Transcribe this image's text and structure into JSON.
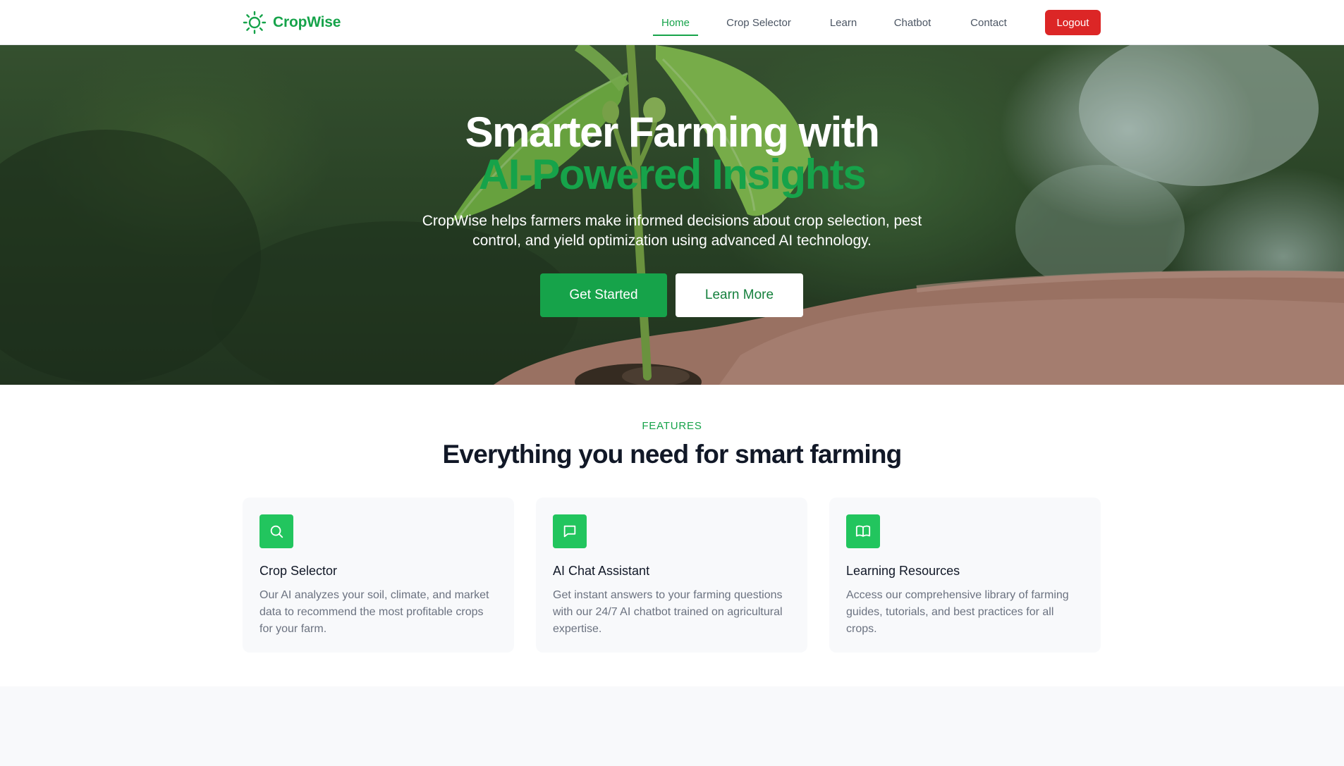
{
  "brand": {
    "name": "CropWise",
    "icon": "sun-icon",
    "color": "#16a34a"
  },
  "nav": {
    "items": [
      {
        "label": "Home",
        "active": true
      },
      {
        "label": "Crop Selector",
        "active": false
      },
      {
        "label": "Learn",
        "active": false
      },
      {
        "label": "Chatbot",
        "active": false
      },
      {
        "label": "Contact",
        "active": false
      }
    ],
    "logout_label": "Logout"
  },
  "hero": {
    "title_line1": "Smarter Farming with",
    "title_line2": "AI-Powered Insights",
    "subtitle": "CropWise helps farmers make informed decisions about crop selection, pest control, and yield optimization using advanced AI technology.",
    "primary_button": "Get Started",
    "secondary_button": "Learn More"
  },
  "features": {
    "eyebrow": "FEATURES",
    "title": "Everything you need for smart farming",
    "cards": [
      {
        "icon": "search-icon",
        "title": "Crop Selector",
        "text": "Our AI analyzes your soil, climate, and market data to recommend the most profitable crops for your farm."
      },
      {
        "icon": "chat-icon",
        "title": "AI Chat Assistant",
        "text": "Get instant answers to your farming questions with our 24/7 AI chatbot trained on agricultural expertise."
      },
      {
        "icon": "book-icon",
        "title": "Learning Resources",
        "text": "Access our comprehensive library of farming guides, tutorials, and best practices for all crops."
      }
    ]
  },
  "colors": {
    "accent": "#16a34a",
    "icon_bg": "#22c55e",
    "danger": "#dc2626",
    "text_dark": "#111827",
    "text_muted": "#6b7280"
  }
}
